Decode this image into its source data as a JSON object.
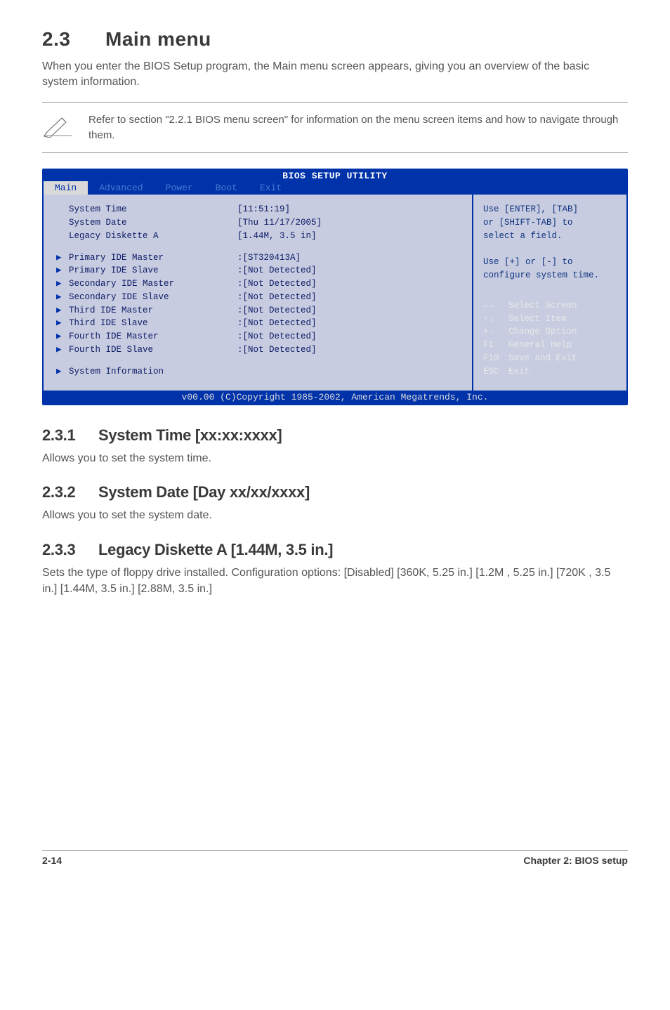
{
  "header": {
    "number": "2.3",
    "title": "Main menu",
    "intro": "When you enter the BIOS Setup program, the Main menu screen appears, giving you an overview of the basic system information.",
    "note": "Refer to section \"2.2.1  BIOS menu screen\" for information on the menu screen items and how to navigate through them."
  },
  "bios": {
    "util_title": "BIOS SETUP UTILITY",
    "tabs": [
      "Main",
      "Advanced",
      "Power",
      "Boot",
      "Exit"
    ],
    "top_rows": [
      {
        "label": "System Time",
        "value": "[11:51:19]"
      },
      {
        "label": "System Date",
        "value": "[Thu 11/17/2005]"
      },
      {
        "label": "Legacy Diskette A",
        "value": "[1.44M, 3.5 in]"
      }
    ],
    "ide_rows": [
      {
        "label": "Primary IDE Master",
        "value": ":[ST320413A]"
      },
      {
        "label": "Primary IDE Slave",
        "value": ":[Not Detected]"
      },
      {
        "label": "Secondary IDE Master",
        "value": ":[Not Detected]"
      },
      {
        "label": "Secondary IDE Slave",
        "value": ":[Not Detected]"
      },
      {
        "label": "Third IDE Master",
        "value": ":[Not Detected]"
      },
      {
        "label": "Third IDE Slave",
        "value": ":[Not Detected]"
      },
      {
        "label": "Fourth IDE Master",
        "value": ":[Not Detected]"
      },
      {
        "label": "Fourth IDE Slave",
        "value": ":[Not Detected]"
      }
    ],
    "sys_info": "System Information",
    "help_top": "Use [ENTER], [TAB]\nor [SHIFT-TAB] to\nselect a field.\n\nUse [+] or [-] to\nconfigure system time.",
    "hints": [
      {
        "key": "←→",
        "desc": "Select Screen"
      },
      {
        "key": "↑↓",
        "desc": "Select Item"
      },
      {
        "key": "+-",
        "desc": "Change Option"
      },
      {
        "key": "F1",
        "desc": "General Help"
      },
      {
        "key": "F10",
        "desc": "Save and Exit"
      },
      {
        "key": "ESC",
        "desc": "Exit"
      }
    ],
    "copyright": "v00.00 (C)Copyright 1985-2002, American Megatrends, Inc."
  },
  "subs": [
    {
      "num": "2.3.1",
      "title": "System Time [xx:xx:xxxx]",
      "body": "Allows you to set the system time."
    },
    {
      "num": "2.3.2",
      "title": "System Date [Day xx/xx/xxxx]",
      "body": "Allows you to set the system date."
    },
    {
      "num": "2.3.3",
      "title": "Legacy Diskette A [1.44M, 3.5 in.]",
      "body": "Sets the type of floppy drive installed. Configuration options: [Disabled] [360K, 5.25 in.] [1.2M , 5.25 in.] [720K , 3.5 in.] [1.44M, 3.5 in.] [2.88M, 3.5 in.]"
    }
  ],
  "footer": {
    "page": "2-14",
    "chapter": "Chapter 2: BIOS setup"
  }
}
